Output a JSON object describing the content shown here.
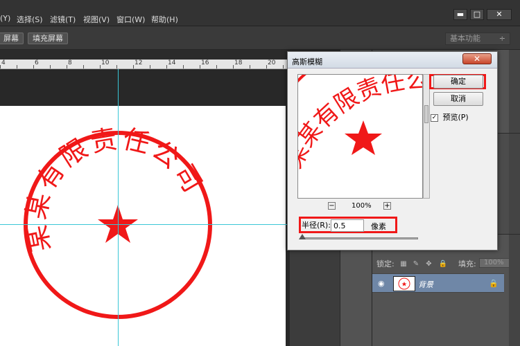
{
  "menu": {
    "items": [
      "(Y)",
      "选择(S)",
      "滤镜(T)",
      "视图(V)",
      "窗口(W)",
      "帮助(H)"
    ]
  },
  "window_controls": {
    "minimize": "▬",
    "maximize": "□",
    "close": "✕"
  },
  "options_bar": {
    "fit_screen": "屏幕",
    "fill_screen": "填充屏幕",
    "workspace": "基本功能",
    "workspace_chevron": "÷"
  },
  "ruler": {
    "labels": [
      "4",
      "6",
      "8",
      "10",
      "12",
      "14",
      "16",
      "18",
      "20"
    ]
  },
  "stamp": {
    "text": "某某有限责任公司",
    "color": "#f01818"
  },
  "dialog": {
    "title": "高斯模糊",
    "close_label": "✕",
    "ok": "确定",
    "cancel": "取消",
    "preview_label": "预览(P)",
    "preview_checked": true,
    "zoom_out": "−",
    "zoom_level": "100%",
    "zoom_in": "+",
    "radius_label": "半径(R):",
    "radius_value": "0.5",
    "radius_unit": "像素",
    "highlight_color": "#f01818"
  },
  "layers_panel": {
    "lock_label": "锁定:",
    "fill_label": "填充:",
    "fill_value": "100%",
    "layer_name": "背景"
  },
  "colors": {
    "guide": "#39c6d6",
    "selected_layer": "#6f87a7",
    "panel": "#535353"
  }
}
